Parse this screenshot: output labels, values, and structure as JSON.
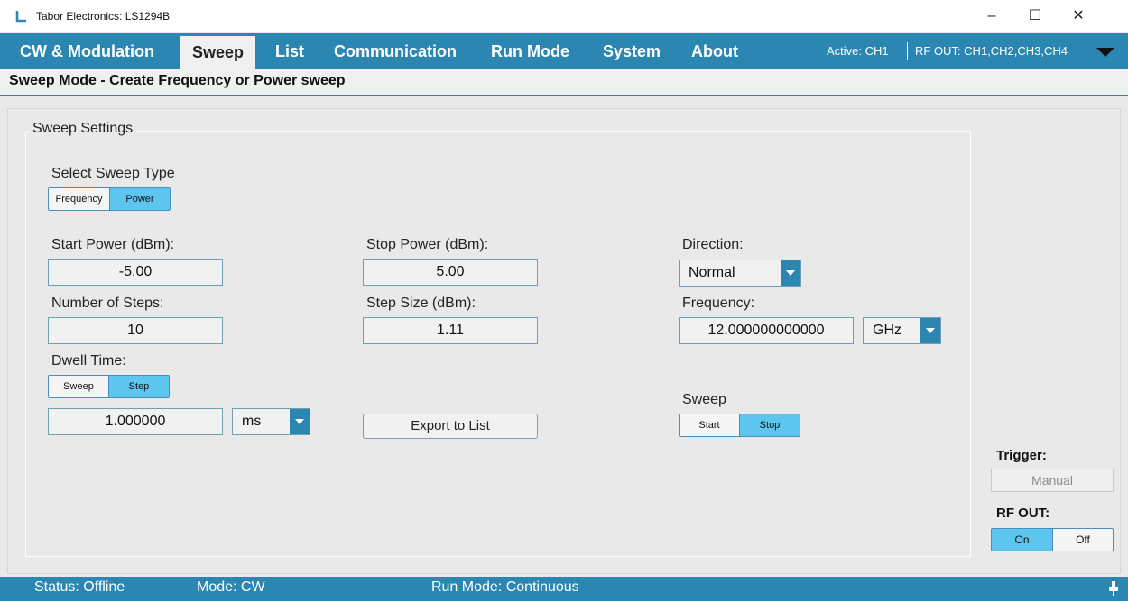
{
  "window": {
    "title": "Tabor Electronics: LS1294B",
    "controls": {
      "minimize": "–",
      "maximize": "☐",
      "close": "✕"
    }
  },
  "menu": {
    "items": [
      "CW & Modulation",
      "Sweep",
      "List",
      "Communication",
      "Run Mode",
      "System",
      "About"
    ],
    "active_index": 1,
    "active_channel": "Active:  CH1",
    "rf_out": "RF OUT:  CH1,CH2,CH3,CH4"
  },
  "subheader": {
    "title": "Sweep Mode - Create Frequency or Power sweep"
  },
  "sweep_settings": {
    "group_title": "Sweep Settings",
    "sweep_type_label": "Select Sweep Type",
    "sweep_type_options": [
      "Frequency",
      "Power"
    ],
    "sweep_type_selected": "Power",
    "start_power_label": "Start Power (dBm):",
    "start_power_value": "-5.00",
    "stop_power_label": "Stop Power (dBm):",
    "stop_power_value": "5.00",
    "direction_label": "Direction:",
    "direction_value": "Normal",
    "steps_label": "Number of Steps:",
    "steps_value": "10",
    "step_size_label": "Step Size (dBm):",
    "step_size_value": "1.11",
    "frequency_label": "Frequency:",
    "frequency_value": "12.000000000000",
    "frequency_unit": "GHz",
    "dwell_label": "Dwell Time:",
    "dwell_options": [
      "Sweep",
      "Step"
    ],
    "dwell_selected": "Step",
    "dwell_value": "1.000000",
    "dwell_unit": "ms",
    "export_button": "Export to List",
    "sweep_label": "Sweep",
    "sweep_options": [
      "Start",
      "Stop"
    ],
    "sweep_selected": "Stop"
  },
  "side_panel": {
    "trigger_label": "Trigger:",
    "manual_button": "Manual",
    "rfout_label": "RF OUT:",
    "rfout_options": [
      "On",
      "Off"
    ],
    "rfout_selected": "On"
  },
  "status": {
    "status": "Status: Offline",
    "mode": "Mode: CW",
    "run_mode": "Run Mode: Continuous"
  },
  "colors": {
    "accent": "#2b86b2",
    "selected": "#5dc6ef"
  }
}
